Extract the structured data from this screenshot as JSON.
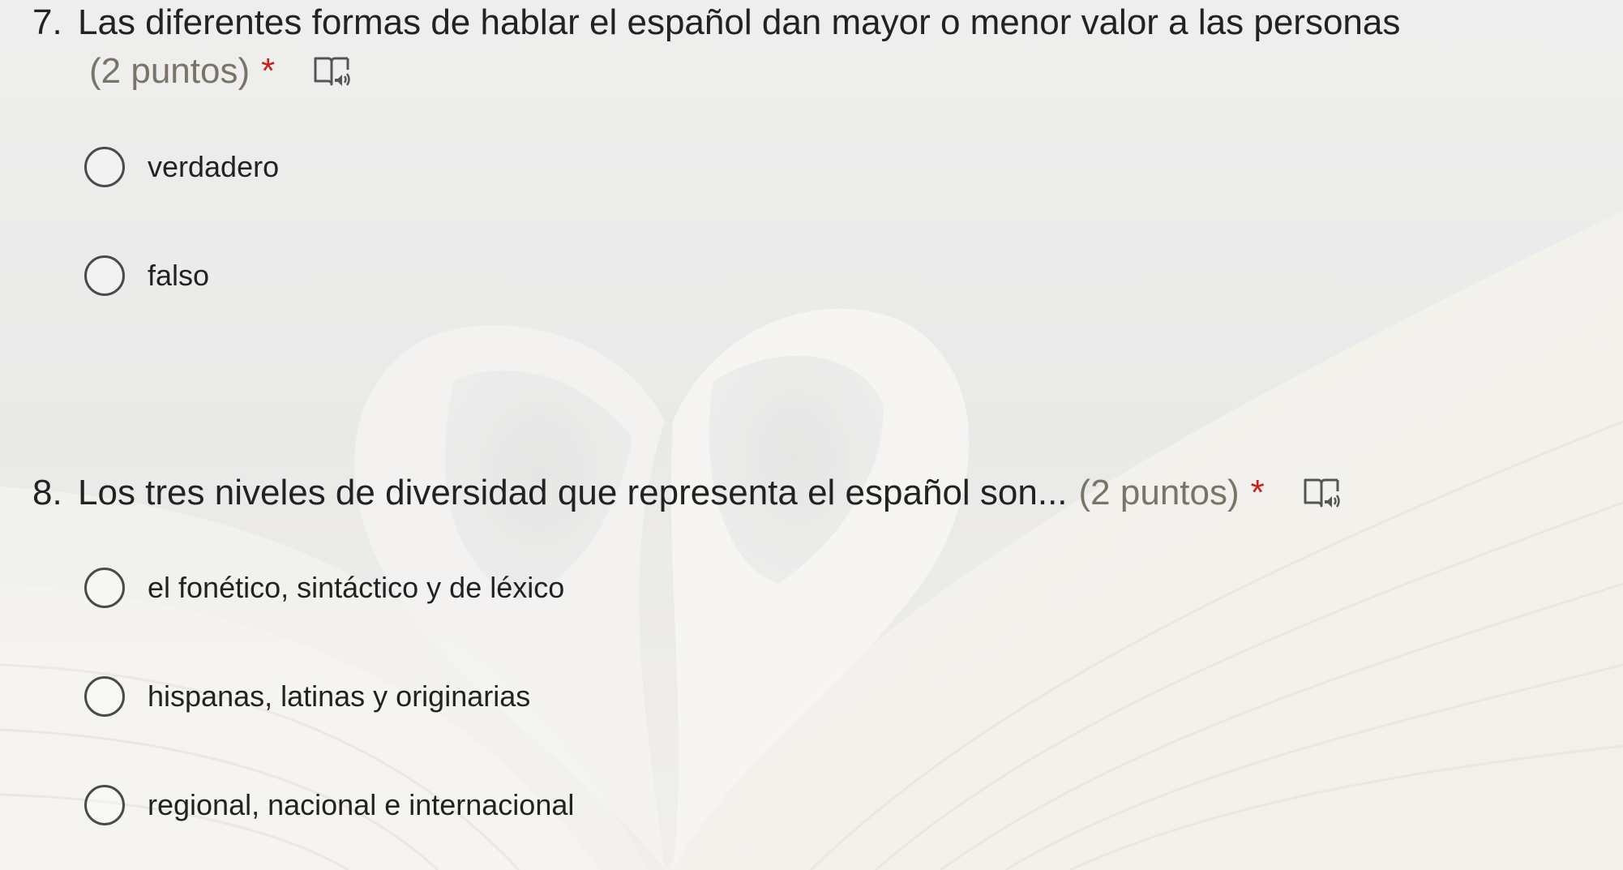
{
  "questions": [
    {
      "number": "7.",
      "text": "Las diferentes formas de hablar el español dan mayor o menor valor a las personas",
      "points": "(2 puntos)",
      "required_mark": "*",
      "reader_icon": "immersive-reader-icon",
      "options": [
        "verdadero",
        "falso"
      ]
    },
    {
      "number": "8.",
      "text": "Los tres niveles de diversidad que representa el español son...",
      "points": "(2 puntos)",
      "required_mark": "*",
      "reader_icon": "immersive-reader-icon",
      "options": [
        "el fonético, sintáctico y de léxico",
        "hispanas, latinas y originarias",
        "regional, nacional e internacional"
      ]
    }
  ],
  "colors": {
    "required": "#c5221f",
    "points": "#7a7468",
    "radio_border": "#4a4a4a"
  }
}
